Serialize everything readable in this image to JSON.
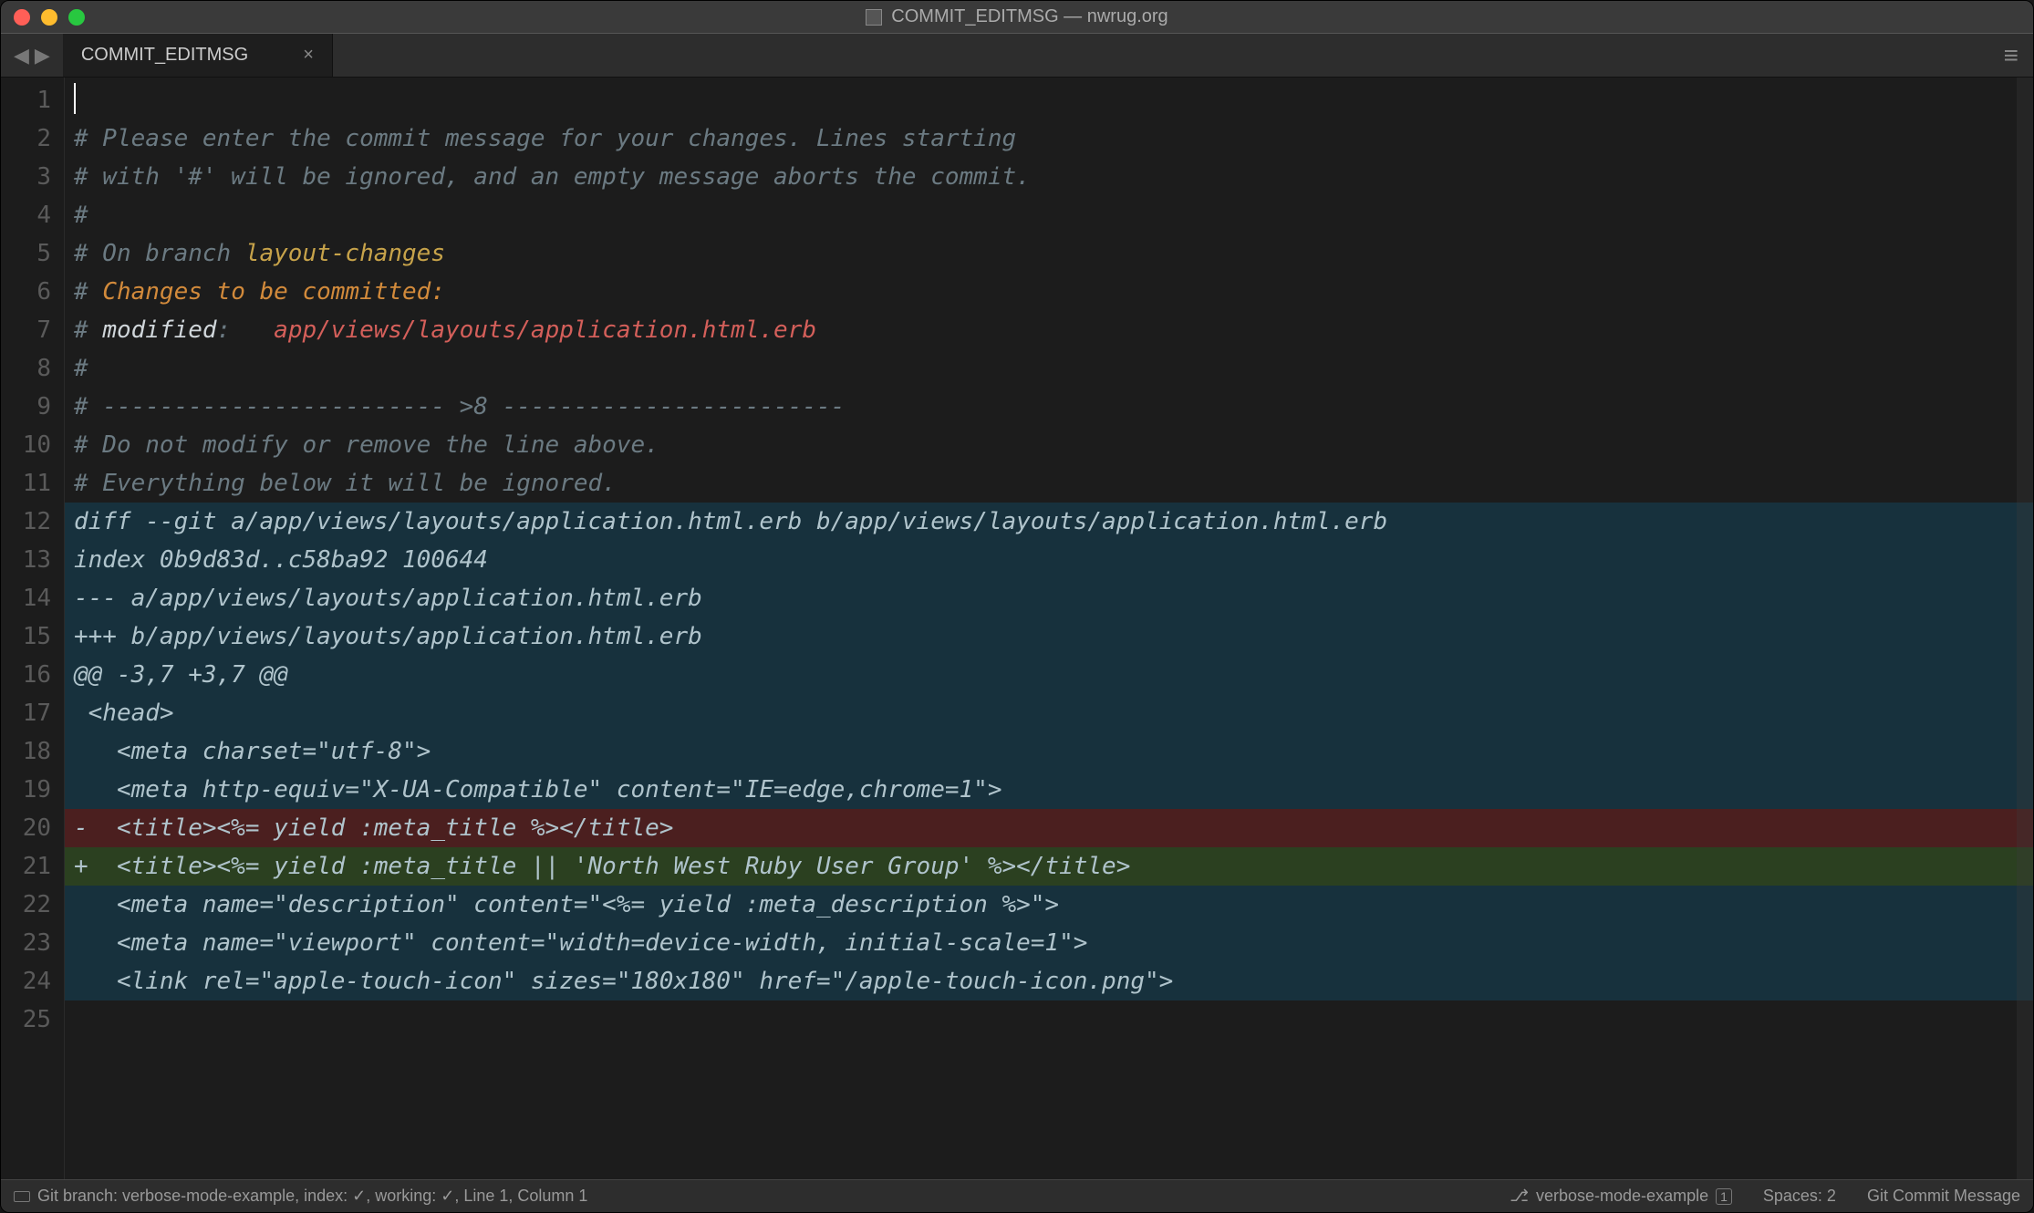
{
  "window": {
    "title": "COMMIT_EDITMSG — nwrug.org"
  },
  "tab": {
    "label": "COMMIT_EDITMSG",
    "close": "×"
  },
  "nav": {
    "prev": "◀",
    "next": "▶"
  },
  "menu_icon": "≡",
  "gutter": [
    "1",
    "2",
    "3",
    "4",
    "5",
    "6",
    "7",
    "8",
    "9",
    "10",
    "11",
    "12",
    "13",
    "14",
    "15",
    "16",
    "17",
    "18",
    "19",
    "20",
    "21",
    "22",
    "23",
    "24",
    "25"
  ],
  "lines": {
    "l1": "",
    "l2a": "# Please enter the commit message for your changes. Lines starting",
    "l3a": "# with '#' will be ignored, and an empty message aborts the commit.",
    "l4a": "#",
    "l5a": "# On branch",
    "l5b": " layout-changes",
    "l6a": "# ",
    "l6b": "Changes to be committed:",
    "l7a": "# ",
    "l7b": "modified",
    "l7c": ":   ",
    "l7d": "app/views/layouts/application.html.erb",
    "l8a": "#",
    "l9a": "# ",
    "l9b": "------------------------ >8 ------------------------",
    "l10a": "# Do not modify or remove the line above.",
    "l11a": "# Everything below it will be ignored.",
    "l12a": "diff --git a/app/views/layouts/application.html.erb b/app/views/layouts/application.html.erb",
    "l13a": "index 0b9d83d..c58ba92 100644",
    "l14a": "--- a/app/views/layouts/application.html.erb",
    "l15a": "+++ b/app/views/layouts/application.html.erb",
    "l16a": "@@ -3,7 +3,7 @@",
    "l17a": " <head>",
    "l18a": "   <meta charset=\"utf-8\">",
    "l19a": "   <meta http-equiv=\"X-UA-Compatible\" content=\"IE=edge,chrome=1\">",
    "l20a": "-  <title><%= yield :meta_title %></title>",
    "l21a": "+  <title><%= yield :meta_title || 'North West Ruby User Group' %></title>",
    "l22a": "   <meta name=\"description\" content=\"<%= yield :meta_description %>\">",
    "l23a": "   <meta name=\"viewport\" content=\"width=device-width, initial-scale=1\">",
    "l24a": "   <link rel=\"apple-touch-icon\" sizes=\"180x180\" href=\"/apple-touch-icon.png\">",
    "l25a": ""
  },
  "status": {
    "left": "Git branch: verbose-mode-example, index: ✓, working: ✓, Line 1, Column 1",
    "branch_icon": "⎇",
    "branch": "verbose-mode-example",
    "badge": "1",
    "spaces": "Spaces: 2",
    "syntax": "Git Commit Message"
  }
}
